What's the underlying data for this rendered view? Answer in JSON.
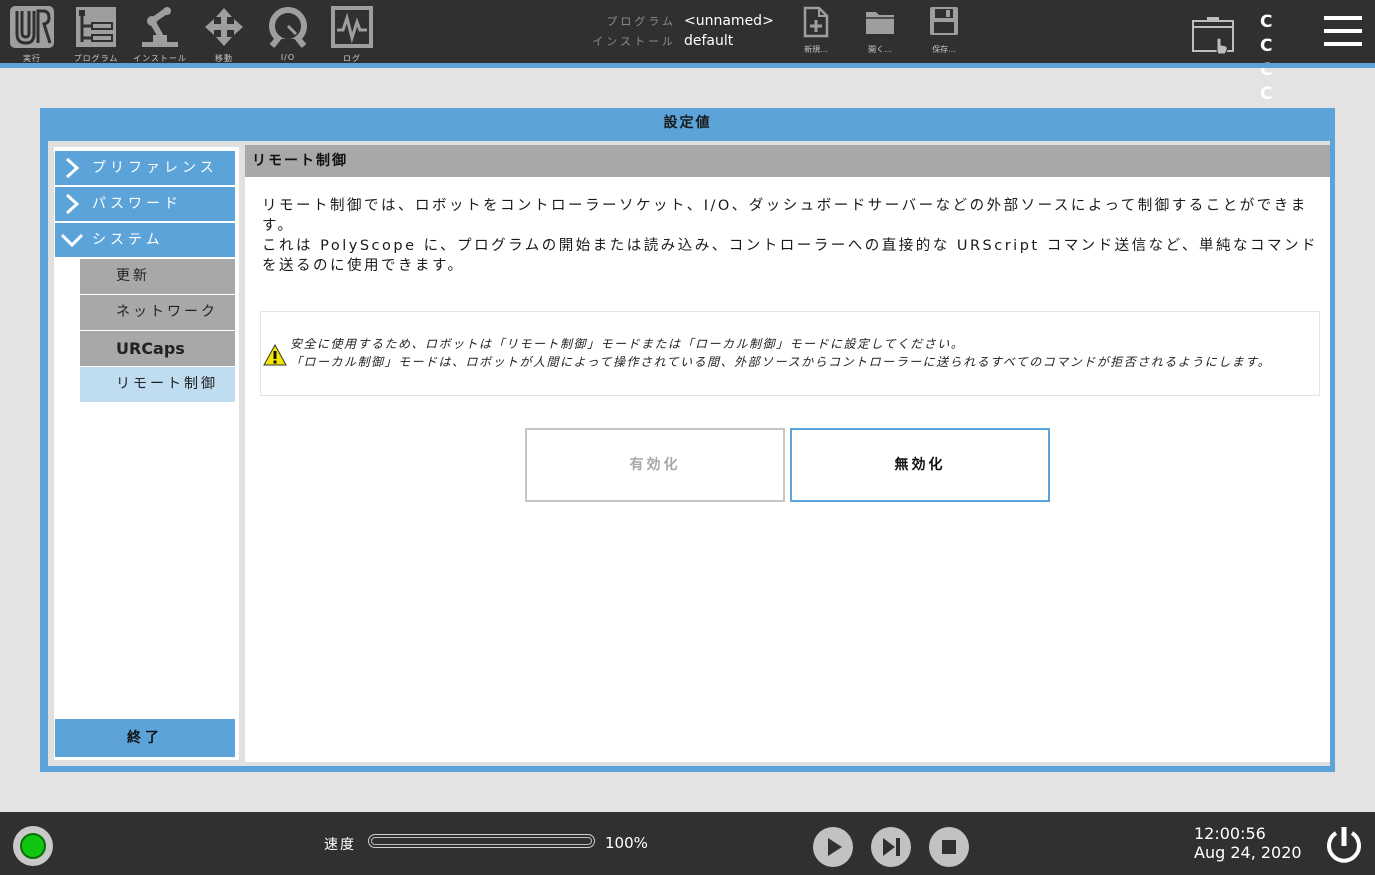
{
  "topbar": {
    "nav": [
      {
        "id": "run",
        "label": "実行",
        "icon": "ur-logo-icon"
      },
      {
        "id": "program",
        "label": "プログラム",
        "icon": "program-tree-icon"
      },
      {
        "id": "installation",
        "label": "インストール",
        "icon": "robot-arm-icon"
      },
      {
        "id": "move",
        "label": "移動",
        "icon": "move-arrows-icon"
      },
      {
        "id": "io",
        "label": "I/O",
        "icon": "io-gauge-icon"
      },
      {
        "id": "log",
        "label": "ログ",
        "icon": "log-waveform-icon"
      }
    ],
    "program_key": "プログラム",
    "program_value": "<unnamed>",
    "install_key": "インストール",
    "install_value": "default",
    "file": {
      "new_label": "新規...",
      "open_label": "開く...",
      "save_label": "保存..."
    },
    "cc_lines": [
      "C C",
      "C C"
    ],
    "accent_color": "#5ba3d8"
  },
  "dialog": {
    "title": "設定値",
    "sidebar": {
      "items": [
        {
          "label": "プリファレンス",
          "expanded": false
        },
        {
          "label": "パスワード",
          "expanded": false
        },
        {
          "label": "システム",
          "expanded": true
        }
      ],
      "subitems": [
        {
          "label": "更新",
          "active": false
        },
        {
          "label": "ネットワーク",
          "active": false
        },
        {
          "label": "URCaps",
          "active": false
        },
        {
          "label": "リモート制御",
          "active": true
        }
      ],
      "exit_label": "終了"
    },
    "content": {
      "header": "リモート制御",
      "desc_line1": "リモート制御では、ロボットをコントローラーソケット、I/O、ダッシュボードサーバーなどの外部ソースによって制御することができます。",
      "desc_line2": "これは PolyScope に、プログラムの開始または読み込み、コントローラーへの直接的な URScript コマンド送信など、単純なコマンドを送るのに使用できます。",
      "warning_line1": "安全に使用するため、ロボットは「リモート制御」モードまたは「ローカル制御」モードに設定してください。",
      "warning_line2": "「ローカル制御」モードは、ロボットが人間によって操作されている間、外部ソースからコントローラーに送られるすべてのコマンドが拒否されるようにします。",
      "enable_label": "有効化",
      "disable_label": "無効化",
      "selected": "disable"
    }
  },
  "bottombar": {
    "status_color": "#11c511",
    "speed_label": "速度",
    "speed_value": "100%",
    "speed_fraction": 1.0,
    "time": "12:00:56",
    "date": "Aug 24, 2020"
  }
}
